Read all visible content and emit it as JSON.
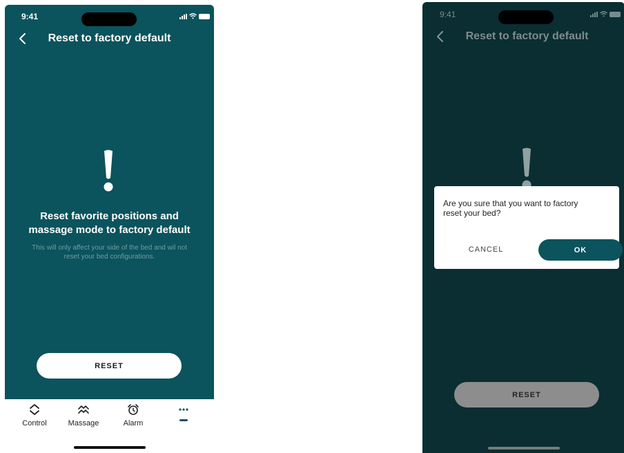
{
  "colors": {
    "screen_bg": "#0b535d",
    "screen_bg_dimmed": "#0a2e32",
    "primary": "#0b535d",
    "white": "#ffffff",
    "muted_text": "#6f9ea3",
    "dimmed_button": "#8d8d8d"
  },
  "screen_left": {
    "status": {
      "time": "9:41"
    },
    "header": {
      "title": "Reset to factory default",
      "back_icon": "chevron-left-icon"
    },
    "alert_icon": "exclamation-icon",
    "heading": {
      "line1": "Reset favorite positions and",
      "line2": "massage mode to factory default"
    },
    "description": {
      "line1": "This will only affect your side of the bed and wil not",
      "line2": "reset your bed configurations."
    },
    "reset_button": "RESET",
    "tab_bar": {
      "items": [
        {
          "label": "Control",
          "icon": "up-down-chevron-icon"
        },
        {
          "label": "Massage",
          "icon": "waves-icon"
        },
        {
          "label": "Alarm",
          "icon": "alarm-clock-icon"
        },
        {
          "label": "",
          "icon": "more-dots-icon",
          "active": true
        }
      ]
    }
  },
  "screen_right": {
    "status": {
      "time": "9:41"
    },
    "header": {
      "title": "Reset to factory default",
      "back_icon": "chevron-left-icon"
    },
    "dialog": {
      "message_line1": "Are you sure that you want to factory",
      "message_line2": "reset your bed?",
      "cancel_label": "CANCEL",
      "ok_label": "OK"
    },
    "reset_button": "RESET"
  }
}
